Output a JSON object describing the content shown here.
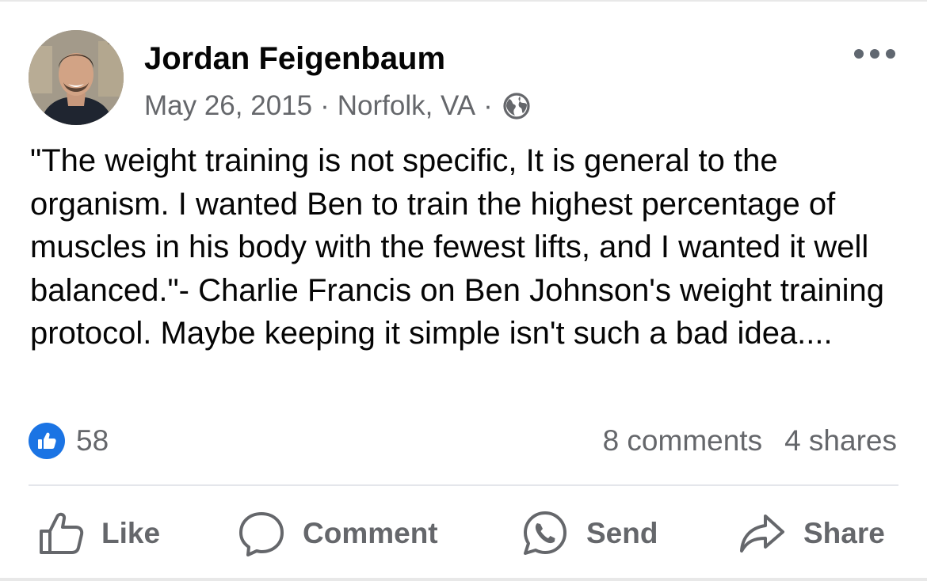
{
  "post": {
    "author": "Jordan Feigenbaum",
    "date": "May 26, 2015",
    "separator": "·",
    "location": "Norfolk, VA",
    "privacy_icon": "globe-icon",
    "more_icon": "more-options-icon",
    "text": "\"The weight training is not specific, It is general to the organism. I wanted Ben to train the highest percentage of muscles in his body with the fewest lifts, and I wanted it well balanced.\"- Charlie Francis on Ben Johnson's weight training protocol. Maybe keeping it simple isn't such a bad idea....",
    "reaction_count": "58",
    "comments": "8 comments",
    "shares": "4 shares"
  },
  "actions": {
    "like": "Like",
    "comment": "Comment",
    "send": "Send",
    "share": "Share"
  },
  "colors": {
    "accent": "#1b74e4",
    "secondary_text": "#65676b",
    "primary_text": "#050505"
  }
}
